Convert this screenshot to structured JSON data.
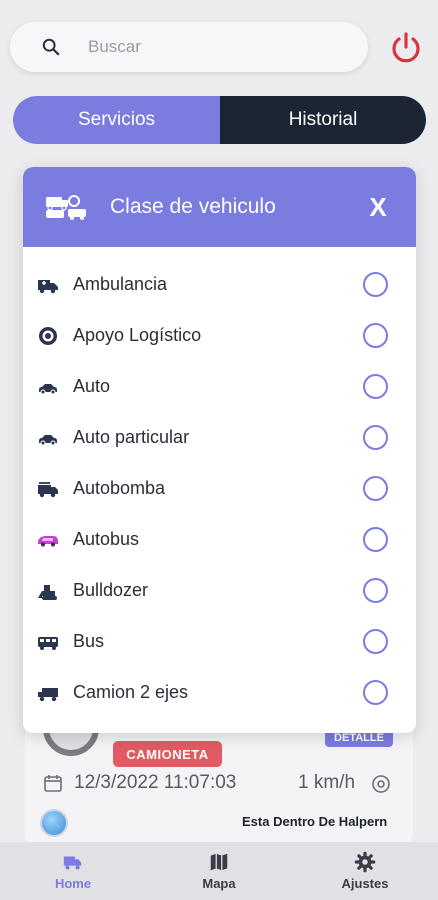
{
  "search": {
    "placeholder": "Buscar"
  },
  "tabs": {
    "services": "Servicios",
    "history": "Historial"
  },
  "background_card": {
    "vehicle_badge": "CAMIONETA",
    "detail_badge": "DETALLE",
    "datetime": "12/3/2022  11:07:03",
    "speed": "1 km/h",
    "location": "Esta Dentro De Halpern"
  },
  "modal": {
    "title": "Clase de vehiculo",
    "close_label": "X",
    "options": [
      {
        "label": "Ambulancia",
        "icon": "ambulance-icon"
      },
      {
        "label": "Apoyo Logístico",
        "icon": "logistics-icon"
      },
      {
        "label": "Auto",
        "icon": "car-icon"
      },
      {
        "label": "Auto particular",
        "icon": "car-icon"
      },
      {
        "label": "Autobomba",
        "icon": "firetruck-icon"
      },
      {
        "label": "Autobus",
        "icon": "bus-pink-icon"
      },
      {
        "label": "Bulldozer",
        "icon": "bulldozer-icon"
      },
      {
        "label": "Bus",
        "icon": "bus-icon"
      },
      {
        "label": "Camion 2 ejes",
        "icon": "truck-icon"
      }
    ]
  },
  "bottom_nav": {
    "home": "Home",
    "map": "Mapa",
    "settings": "Ajustes"
  },
  "colors": {
    "accent": "#7b7ce0",
    "dark": "#1b2533",
    "danger": "#e25b63",
    "power": "#d9343f"
  }
}
